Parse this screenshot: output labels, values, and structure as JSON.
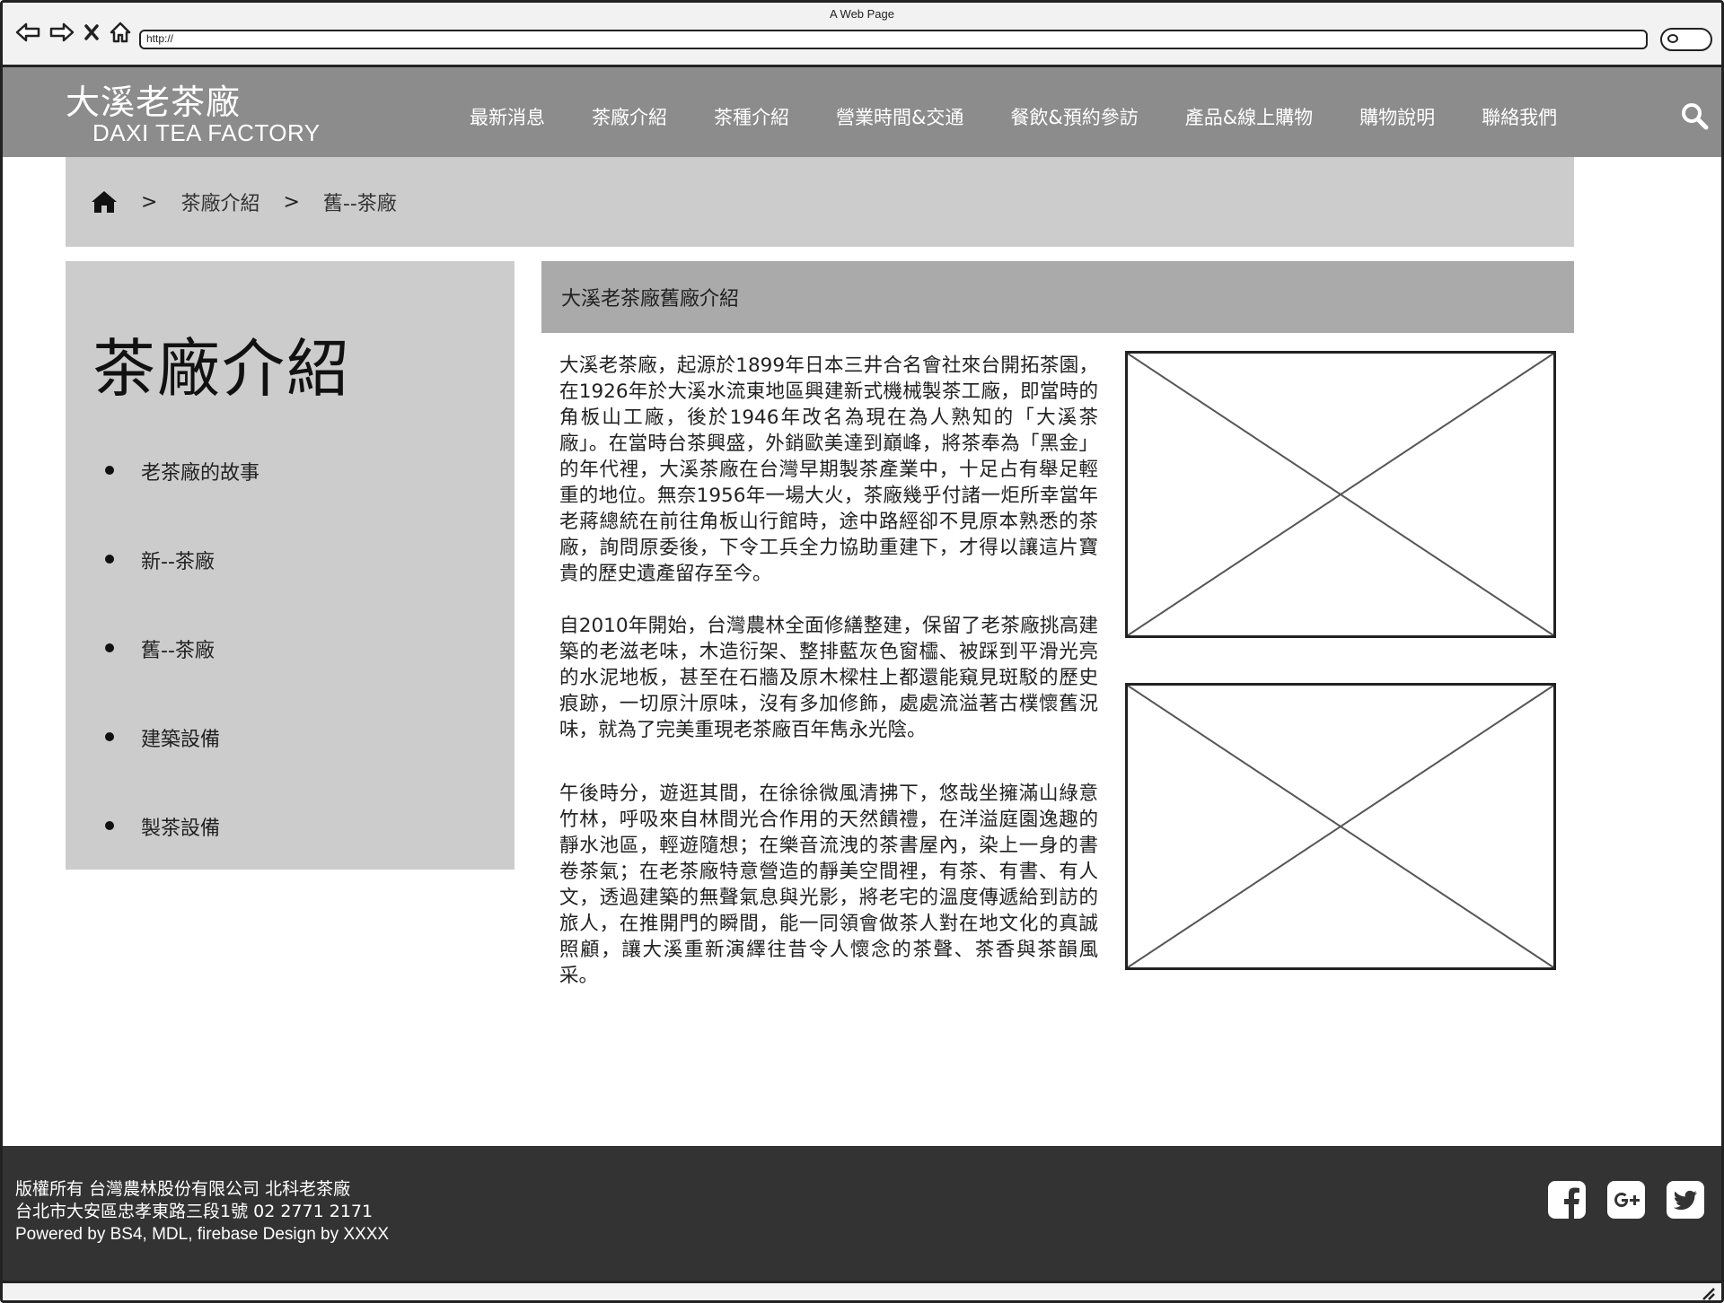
{
  "window": {
    "title": "A Web Page",
    "url": "http://"
  },
  "site": {
    "logo_cn": "大溪老茶廠",
    "logo_en": "DAXI TEA FACTORY",
    "nav": [
      "最新消息",
      "茶廠介紹",
      "茶種介紹",
      "營業時間&交通",
      "餐飲&預約參訪",
      "產品&線上購物",
      "購物說明",
      "聯絡我們"
    ]
  },
  "breadcrumb": {
    "separator": ">",
    "items": [
      "茶廠介紹",
      "舊--茶廠"
    ]
  },
  "sidebar": {
    "title": "茶廠介紹",
    "items": [
      "老茶廠的故事",
      "新--茶廠",
      "舊--茶廠",
      "建築設備",
      "製茶設備"
    ]
  },
  "content": {
    "heading": "大溪老茶廠舊廠介紹",
    "paragraphs": [
      "大溪老茶廠，起源於1899年日本三井合名會社來台開拓茶園，在1926年於大溪水流東地區興建新式機械製茶工廠，即當時的角板山工廠，後於1946年改名為現在為人熟知的「大溪茶廠」。在當時台茶興盛，外銷歐美達到巔峰，將茶奉為「黑金」的年代裡，大溪茶廠在台灣早期製茶產業中，十足占有舉足輕重的地位。無奈1956年一場大火，茶廠幾乎付諸一炬所幸當年老蔣總統在前往角板山行館時，途中路經卻不見原本熟悉的茶廠，詢問原委後，下令工兵全力協助重建下，才得以讓這片寶貴的歷史遺產留存至今。",
      "自2010年開始，台灣農林全面修繕整建，保留了老茶廠挑高建築的老滋老味，木造衍架、整排藍灰色窗櫺、被踩到平滑光亮的水泥地板，甚至在石牆及原木樑柱上都還能窺見斑駁的歷史痕跡，一切原汁原味，沒有多加修飾，處處流溢著古樸懷舊況味，就為了完美重現老茶廠百年雋永光陰。",
      "午後時分，遊逛其間，在徐徐微風清拂下，悠哉坐擁滿山綠意竹林，呼吸來自林間光合作用的天然饋禮，在洋溢庭園逸趣的靜水池區，輕遊隨想；在樂音流洩的茶書屋內，染上一身的書卷茶氣；在老茶廠特意營造的靜美空間裡，有茶、有書、有人文，透過建築的無聲氣息與光影，將老宅的溫度傳遞給到訪的旅人，在推開門的瞬間，能一同領會做茶人對在地文化的真誠照顧，讓大溪重新演繹往昔令人懷念的茶聲、茶香與茶韻風采。"
    ]
  },
  "footer": {
    "line1": "版權所有 台灣農林股份有限公司 北科老茶廠",
    "line2": "台北市大安區忠孝東路三段1號 02 2771 2171",
    "line3": "Powered by BS4, MDL, firebase Design by XXXX",
    "social": [
      "facebook-icon",
      "google-plus-icon",
      "twitter-icon"
    ]
  }
}
